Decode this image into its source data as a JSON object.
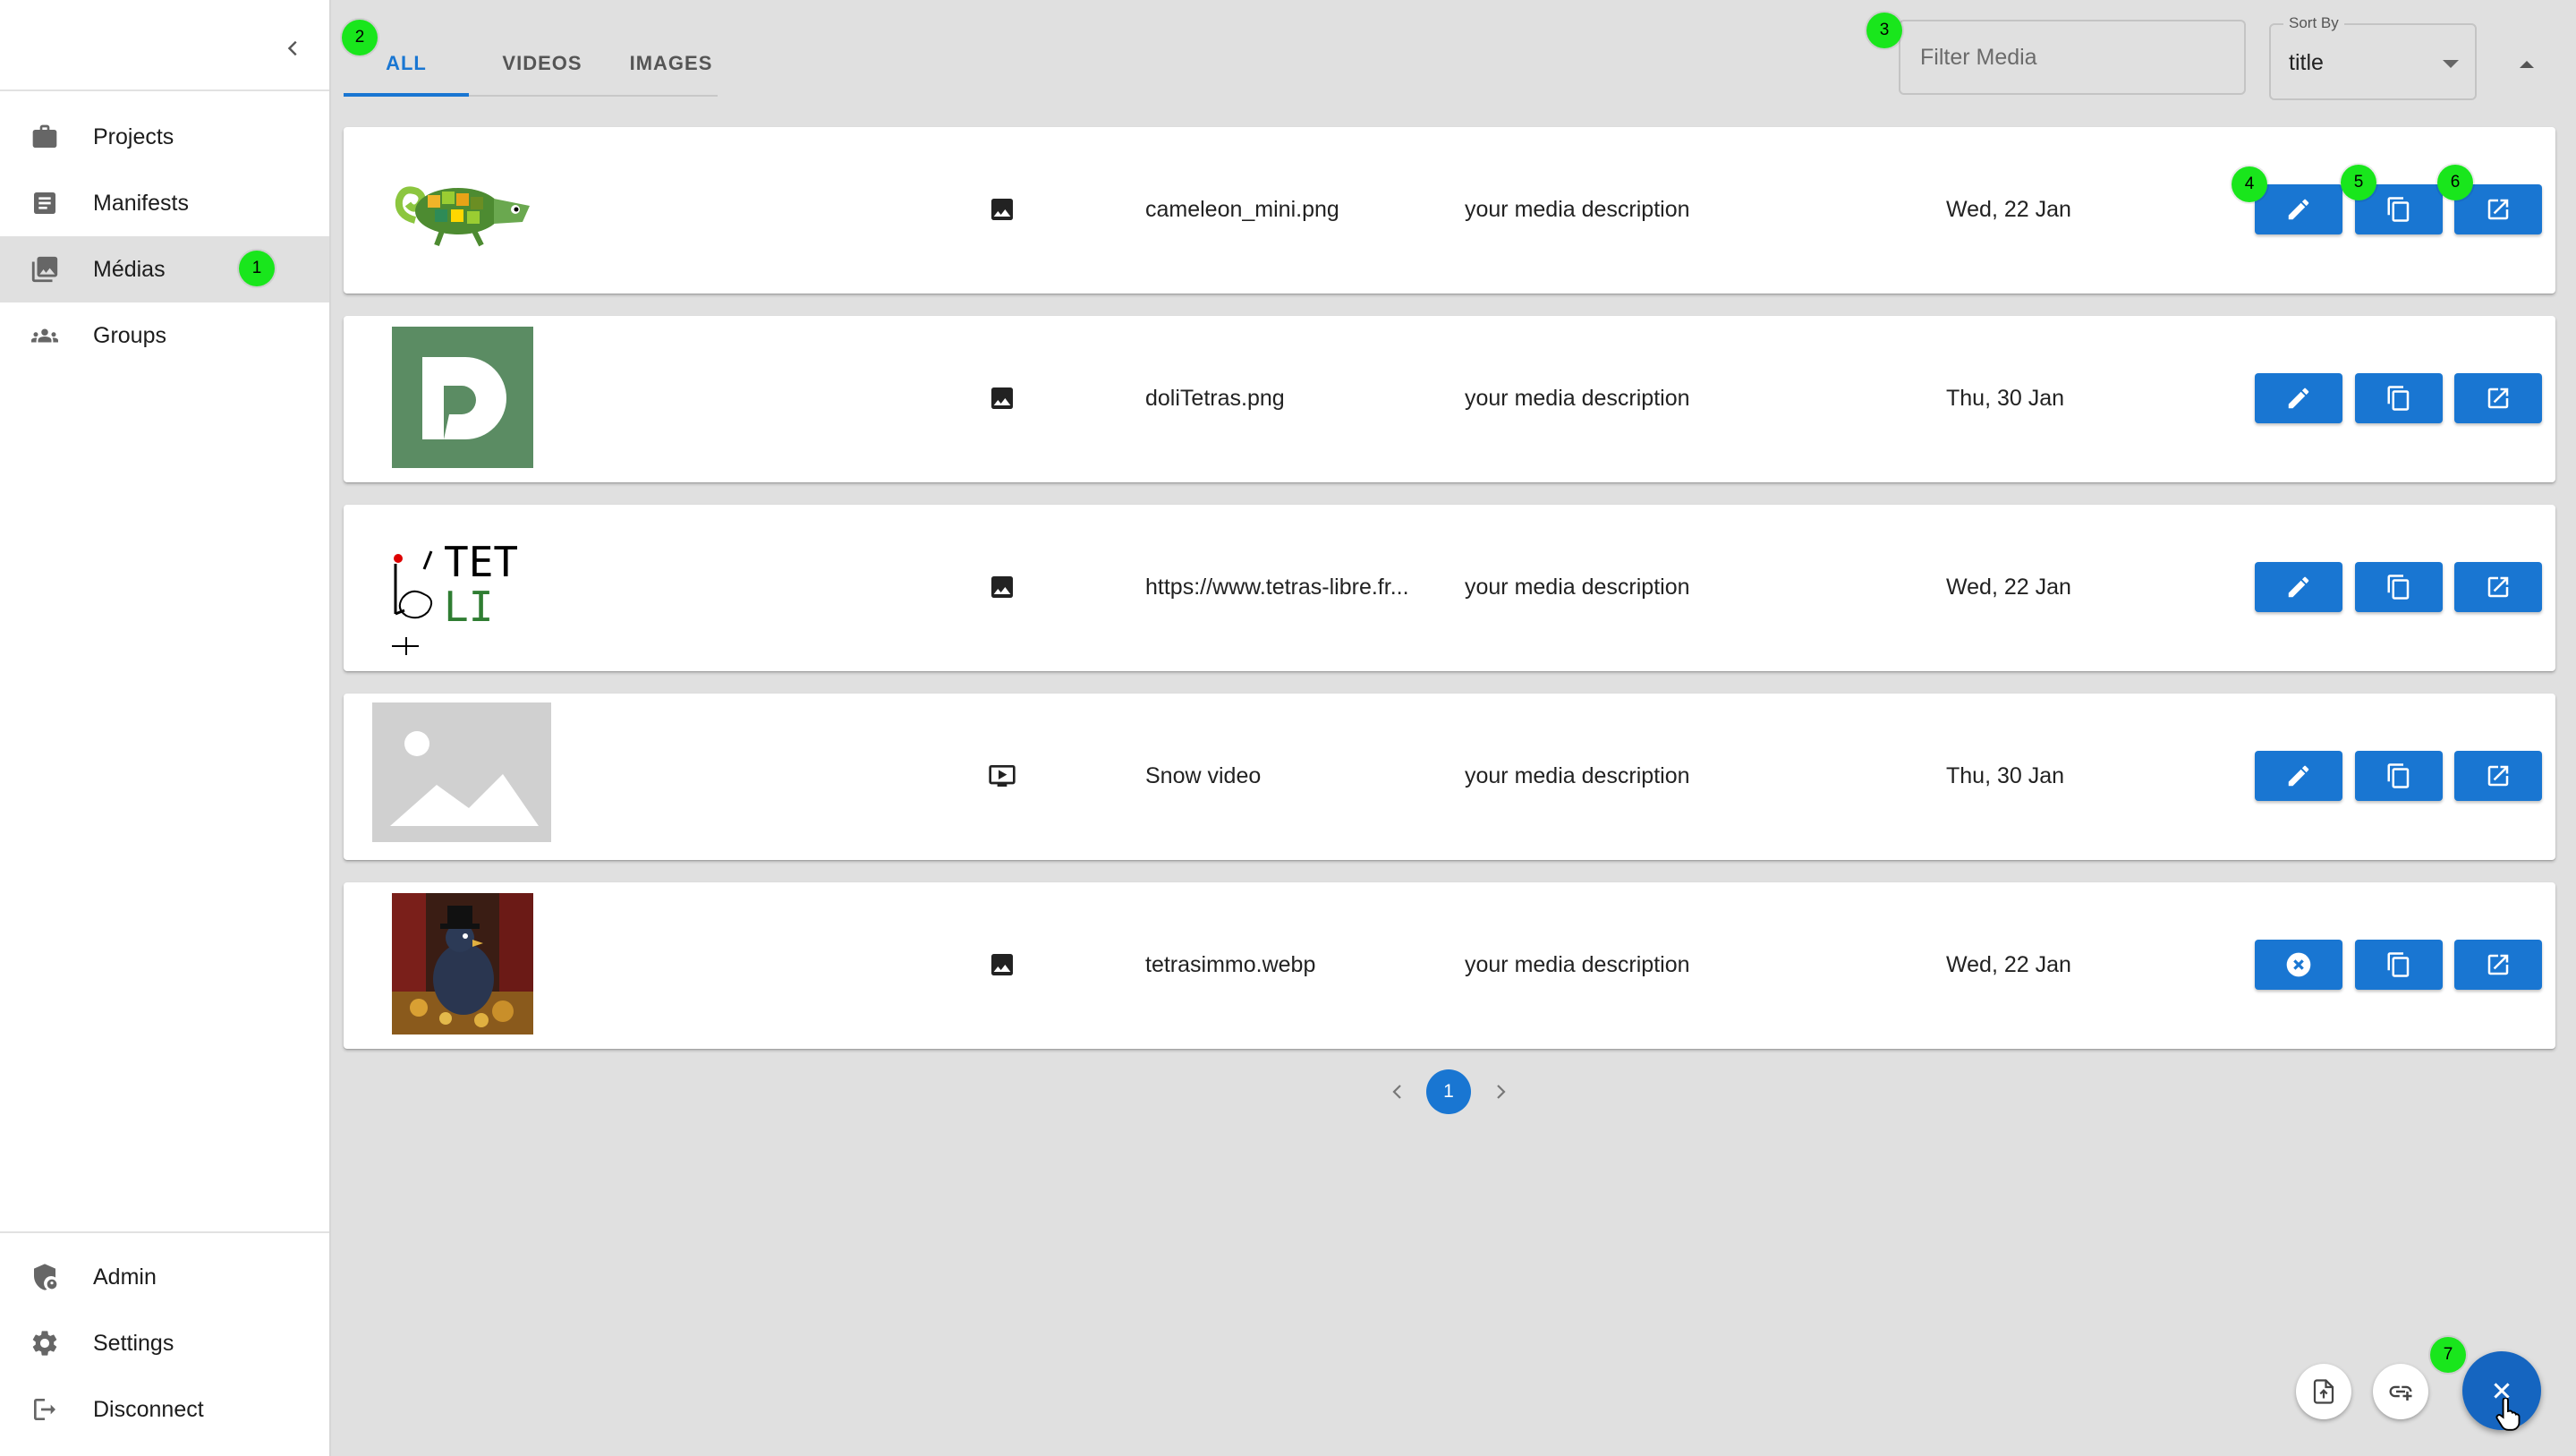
{
  "sidebar": {
    "collapse_icon": "chevron-left-icon",
    "nav": [
      {
        "label": "Projects",
        "icon": "briefcase-icon"
      },
      {
        "label": "Manifests",
        "icon": "document-icon"
      },
      {
        "label": "Médias",
        "icon": "photo-library-icon",
        "active": true
      },
      {
        "label": "Groups",
        "icon": "groups-icon"
      }
    ],
    "bottom": [
      {
        "label": "Admin",
        "icon": "admin-shield-icon"
      },
      {
        "label": "Settings",
        "icon": "gear-icon"
      },
      {
        "label": "Disconnect",
        "icon": "logout-icon"
      }
    ]
  },
  "tabs": [
    {
      "label": "ALL",
      "active": true
    },
    {
      "label": "VIDEOS"
    },
    {
      "label": "IMAGES"
    }
  ],
  "filter": {
    "placeholder": "Filter Media",
    "value": ""
  },
  "sort": {
    "label": "Sort By",
    "value": "title",
    "direction_icon": "arrow-up-icon"
  },
  "media": [
    {
      "thumb": "chameleon",
      "type_icon": "image-icon",
      "name": "cameleon_mini.png",
      "description": "your media description",
      "date": "Wed, 22 Jan",
      "first_action": "edit"
    },
    {
      "thumb": "doli-logo",
      "type_icon": "image-icon",
      "name": "doliTetras.png",
      "description": "your media description",
      "date": "Thu, 30 Jan",
      "first_action": "edit"
    },
    {
      "thumb": "tetras-libre-logo",
      "type_icon": "image-icon",
      "name": "https://www.tetras-libre.fr...",
      "description": "your media description",
      "date": "Wed, 22 Jan",
      "first_action": "edit"
    },
    {
      "thumb": "placeholder",
      "type_icon": "video-icon",
      "name": "Snow video",
      "description": "your media description",
      "date": "Thu, 30 Jan",
      "first_action": "edit"
    },
    {
      "thumb": "painting",
      "type_icon": "image-icon",
      "name": "tetrasimmo.webp",
      "description": "your media description",
      "date": "Wed, 22 Jan",
      "first_action": "remove"
    }
  ],
  "thumb_text": {
    "tetras_top": "TET",
    "tetras_bottom": "LI"
  },
  "pagination": {
    "current": "1"
  },
  "badges": [
    "1",
    "2",
    "3",
    "4",
    "5",
    "6",
    "7"
  ],
  "colors": {
    "primary": "#1976d2",
    "badge": "#19e61c",
    "background": "#e0e0e0"
  }
}
